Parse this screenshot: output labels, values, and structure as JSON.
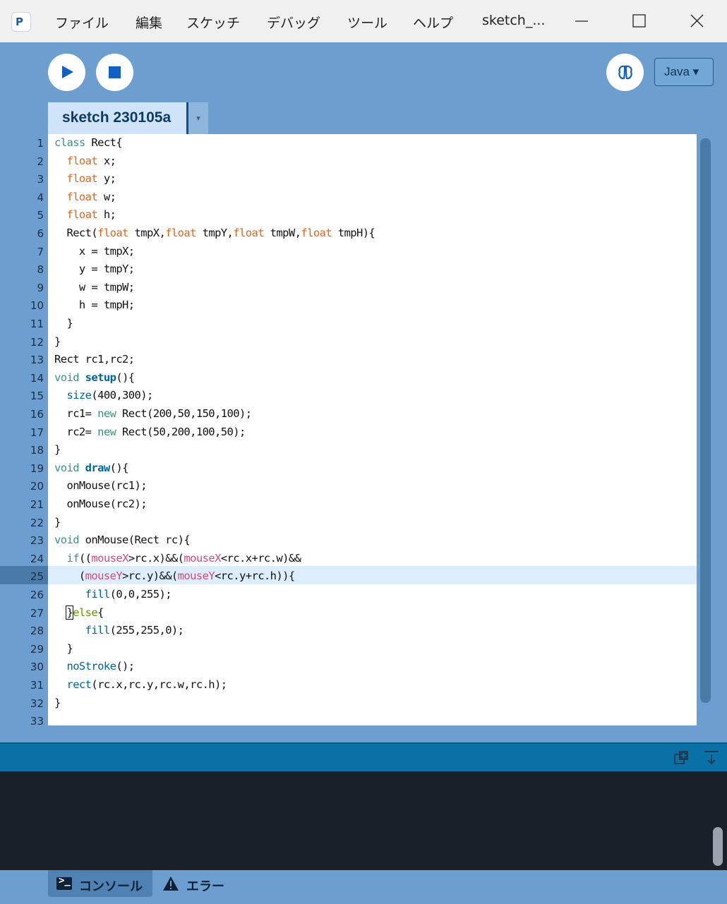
{
  "menu": {
    "items": [
      "ファイル",
      "編集",
      "スケッチ",
      "デバッグ",
      "ツール",
      "ヘルプ"
    ],
    "window_title": "sketch_..."
  },
  "toolbar": {
    "mode_label": "Java ▾"
  },
  "tab": {
    "name": "sketch 230105a",
    "menu_glyph": "▾"
  },
  "editor": {
    "current_line": 25,
    "line_numbers": [
      "1",
      "2",
      "3",
      "4",
      "5",
      "6",
      "7",
      "8",
      "9",
      "10",
      "11",
      "12",
      "13",
      "14",
      "15",
      "16",
      "17",
      "18",
      "19",
      "20",
      "21",
      "22",
      "23",
      "24",
      "25",
      "26",
      "27",
      "28",
      "29",
      "30",
      "31",
      "32",
      "33"
    ]
  },
  "bottom": {
    "console_label": "コンソール",
    "error_label": "エラー"
  },
  "colors": {
    "background": "#6c9fcf",
    "keyword": "#33997e",
    "type": "#e2661a",
    "function": "#006699",
    "mouse_var": "#d94a7a",
    "else_kw": "#669900",
    "console_bar": "#0a71a6"
  }
}
